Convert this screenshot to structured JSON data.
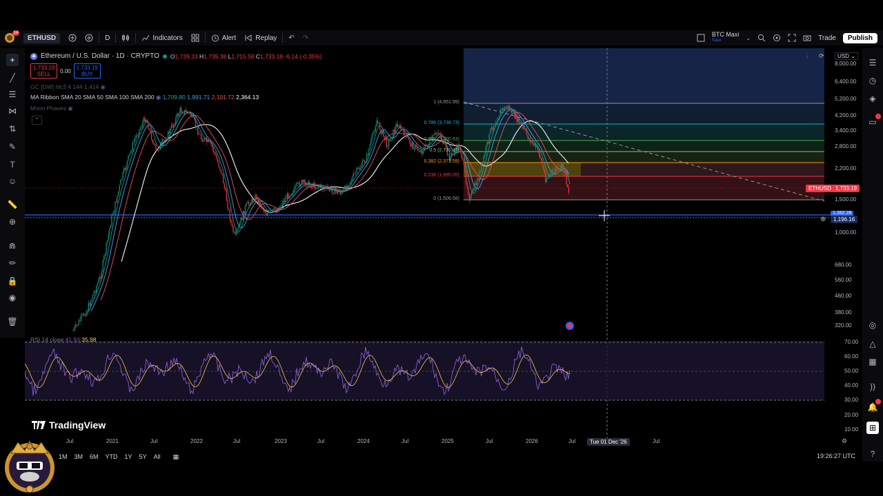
{
  "topbar": {
    "symbol": "ETHUSD",
    "interval": "D",
    "indicators_label": "Indicators",
    "alert_label": "Alert",
    "replay_label": "Replay",
    "profile_name": "BTC Maxi",
    "profile_sub": "Save",
    "trade_label": "Trade",
    "publish_label": "Publish",
    "avatar_badge": "14"
  },
  "legend": {
    "title": "Ethereum / U.S. Dollar · 1D · CRYPTO",
    "o": "O",
    "o_val": "1,739.33",
    "h": "H",
    "h_val": "1,739.38",
    "l": "L",
    "l_val": "1,715.58",
    "c": "C",
    "c_val": "1,733.19",
    "change": "-6.14 (-0.35%)",
    "sell_price": "1,733.19",
    "sell_label": "SELL",
    "spread": "0.00",
    "buy_price": "1,733.19",
    "buy_label": "BUY",
    "gc_line": "GC [DW] hlc3 4 144 1.414",
    "ma_ribbon_label": "MA Ribbon SMA 20 SMA 50 SMA 100 SMA 200",
    "ma_v1": "1,709.80",
    "ma_v2": "1,991.71",
    "ma_v3": "2,101.72",
    "ma_v4": "2,364.13",
    "moon_label": "Moon Phases",
    "rsi_label": "RSI 14 close",
    "rsi_v1": "41.93",
    "rsi_v2": "35.98"
  },
  "fib": [
    {
      "label": "1 (4,951.99)",
      "color": "#9598a1"
    },
    {
      "label": "0.786 (3,738.73)",
      "color": "#00bcd4"
    },
    {
      "label": "0.618 (3,200.63)",
      "color": "#4caf50"
    },
    {
      "label": "0.5 (2,731.45)",
      "color": "#81c784"
    },
    {
      "label": "0.382 (2,373.59)",
      "color": "#ff9800"
    },
    {
      "label": "0.236 (1,995.05)",
      "color": "#f23645"
    },
    {
      "label": "0 (1,506.58)",
      "color": "#9598a1"
    }
  ],
  "price_axis": {
    "currency": "USD",
    "ticks": [
      "8,000.00",
      "6,400.00",
      "5,200.00",
      "4,200.00",
      "3,400.00",
      "2,800.00",
      "2,200.00",
      "1,500.00",
      "1,000.00",
      "680.00",
      "560.00",
      "460.00",
      "380.00",
      "320.00"
    ],
    "current_symbol": "ETHUSD",
    "current_price": "1,733.19",
    "line_price_top": "1,262.28",
    "line_price": "1,196.16"
  },
  "rsi_axis": [
    "70.00",
    "60.00",
    "50.00",
    "40.00",
    "30.00",
    "20.00",
    "10.00"
  ],
  "time_axis": [
    "Jul",
    "2021",
    "Jul",
    "2022",
    "Jul",
    "2023",
    "Jul",
    "2024",
    "Jul",
    "2025",
    "Jul",
    "2026",
    "Jul",
    "Jul"
  ],
  "crosshair_date": "Tue 01 Dec '26",
  "branding": "TradingView",
  "ranges": [
    "1M",
    "3M",
    "6M",
    "YTD",
    "1Y",
    "5Y",
    "All"
  ],
  "clock": "19:26:27 UTC",
  "colors": {
    "accent": "#2962ff",
    "down": "#f23645",
    "up": "#089981",
    "rsi": "#7e57c2"
  }
}
